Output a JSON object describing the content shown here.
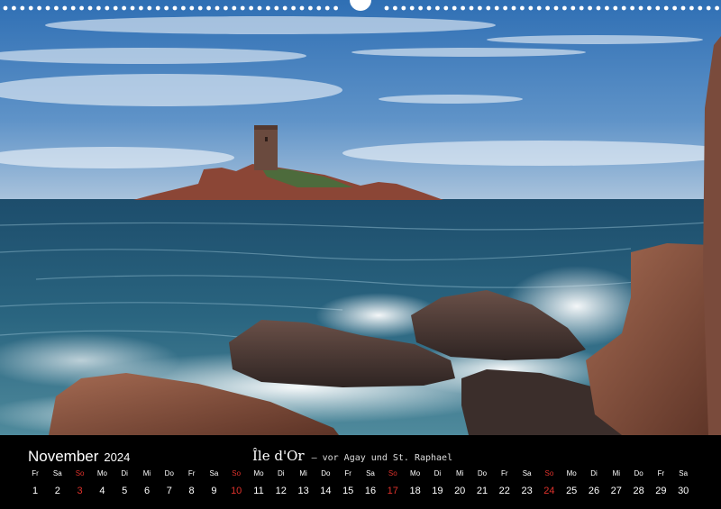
{
  "calendar": {
    "month": "November",
    "year": "2024",
    "title": "Île d'Or",
    "subtitle": "– vor Agay und St. Raphael",
    "days": [
      {
        "wd": "Fr",
        "n": "1"
      },
      {
        "wd": "Sa",
        "n": "2"
      },
      {
        "wd": "So",
        "n": "3"
      },
      {
        "wd": "Mo",
        "n": "4"
      },
      {
        "wd": "Di",
        "n": "5"
      },
      {
        "wd": "Mi",
        "n": "6"
      },
      {
        "wd": "Do",
        "n": "7"
      },
      {
        "wd": "Fr",
        "n": "8"
      },
      {
        "wd": "Sa",
        "n": "9"
      },
      {
        "wd": "So",
        "n": "10"
      },
      {
        "wd": "Mo",
        "n": "11"
      },
      {
        "wd": "Di",
        "n": "12"
      },
      {
        "wd": "Mi",
        "n": "13"
      },
      {
        "wd": "Do",
        "n": "14"
      },
      {
        "wd": "Fr",
        "n": "15"
      },
      {
        "wd": "Sa",
        "n": "16"
      },
      {
        "wd": "So",
        "n": "17"
      },
      {
        "wd": "Mo",
        "n": "18"
      },
      {
        "wd": "Di",
        "n": "19"
      },
      {
        "wd": "Mi",
        "n": "20"
      },
      {
        "wd": "Do",
        "n": "21"
      },
      {
        "wd": "Fr",
        "n": "22"
      },
      {
        "wd": "Sa",
        "n": "23"
      },
      {
        "wd": "So",
        "n": "24"
      },
      {
        "wd": "Mo",
        "n": "25"
      },
      {
        "wd": "Di",
        "n": "26"
      },
      {
        "wd": "Mi",
        "n": "27"
      },
      {
        "wd": "Do",
        "n": "28"
      },
      {
        "wd": "Fr",
        "n": "29"
      },
      {
        "wd": "Sa",
        "n": "30"
      }
    ]
  },
  "colors": {
    "sunday": "#e0322c",
    "footer_bg": "#000000",
    "sky": "#3a78b8",
    "sea": "#1f5470",
    "rock": "#8a4a3a"
  },
  "icons": [
    "spiral-binding-icon",
    "hanger-icon"
  ]
}
